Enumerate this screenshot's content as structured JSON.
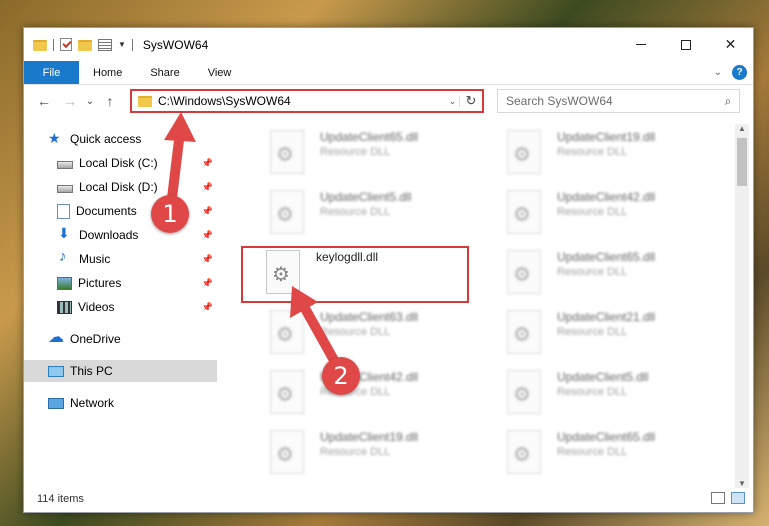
{
  "window": {
    "title": "SysWOW64",
    "controls": {
      "minimize": "–",
      "maximize": "□",
      "close": "✕"
    }
  },
  "ribbon": {
    "tabs": [
      "File",
      "Home",
      "Share",
      "View"
    ],
    "help": "?",
    "collapse": "⌄"
  },
  "nav": {
    "back": "←",
    "forward": "→",
    "recent": "⌄",
    "up": "↑",
    "address": "C:\\Windows\\SysWOW64",
    "address_dropdown": "⌄",
    "refresh": "↻",
    "search_placeholder": "Search SysWOW64",
    "search_icon": "⌕"
  },
  "sidebar": {
    "items": [
      {
        "label": "Quick access",
        "icon": "star-icon"
      },
      {
        "label": "Local Disk (C:)",
        "icon": "disk-icon",
        "pinned": true
      },
      {
        "label": "Local Disk (D:)",
        "icon": "disk-icon",
        "pinned": true
      },
      {
        "label": "Documents",
        "icon": "documents-icon",
        "pinned": true
      },
      {
        "label": "Downloads",
        "icon": "download-icon",
        "pinned": true
      },
      {
        "label": "Music",
        "icon": "music-icon",
        "pinned": true
      },
      {
        "label": "Pictures",
        "icon": "pictures-icon",
        "pinned": true
      },
      {
        "label": "Videos",
        "icon": "videos-icon",
        "pinned": true
      },
      {
        "label": "OneDrive",
        "icon": "cloud-icon"
      },
      {
        "label": "This PC",
        "icon": "computer-icon",
        "selected": true
      },
      {
        "label": "Network",
        "icon": "network-icon"
      }
    ],
    "pin_glyph": "📌"
  },
  "files": [
    {
      "name": "UpdateClient65.dll",
      "type": "Resource DLL"
    },
    {
      "name": "UpdateClient19.dll",
      "type": "Resource DLL"
    },
    {
      "name": "UpdateClient5.dll",
      "type": "Resource DLL"
    },
    {
      "name": "UpdateClient42.dll",
      "type": "Resource DLL"
    },
    {
      "name": "keylogdll.dll",
      "type": ""
    },
    {
      "name": "UpdateClient65.dll",
      "type": "Resource DLL"
    },
    {
      "name": "UpdateClient63.dll",
      "type": "Resource DLL"
    },
    {
      "name": "UpdateClient21.dll",
      "type": "Resource DLL"
    },
    {
      "name": "UpdateClient42.dll",
      "type": "Resource DLL"
    },
    {
      "name": "UpdateClient5.dll",
      "type": "Resource DLL"
    },
    {
      "name": "UpdateClient19.dll",
      "type": "Resource DLL"
    },
    {
      "name": "UpdateClient65.dll",
      "type": "Resource DLL"
    }
  ],
  "status": {
    "item_count": "114 items"
  },
  "annotations": {
    "step1": "1",
    "step2": "2",
    "color": "#e04848"
  }
}
